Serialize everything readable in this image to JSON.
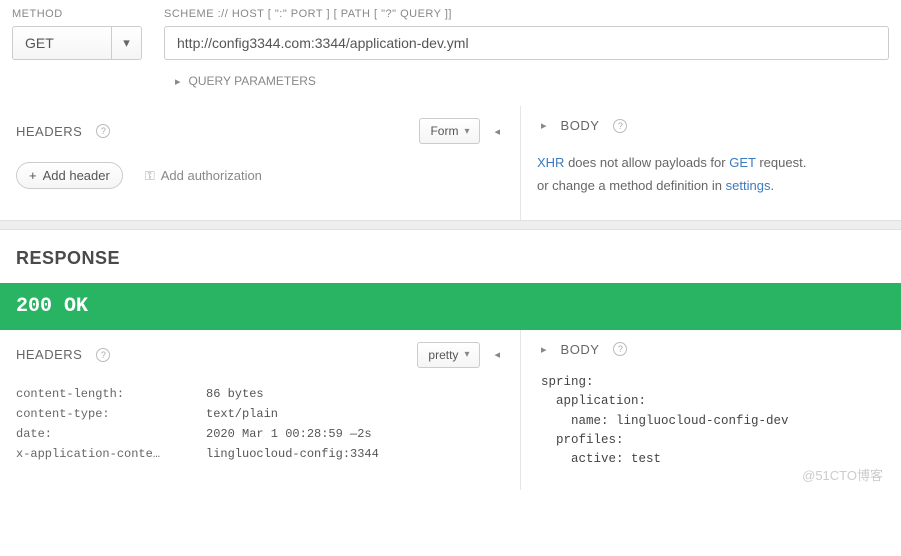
{
  "request": {
    "method_label": "METHOD",
    "method_value": "GET",
    "url_label": "SCHEME :// HOST [ \":\" PORT ] [ PATH [ \"?\" QUERY ]]",
    "url_value": "http://config3344.com:3344/application-dev.yml",
    "query_params_label": "QUERY PARAMETERS",
    "headers_label": "HEADERS",
    "form_label": "Form",
    "add_header": "Add header",
    "add_auth": "Add authorization",
    "body_label": "BODY",
    "body_msg_1a": "XHR",
    "body_msg_1b": " does not allow payloads for ",
    "body_msg_1c": "GET",
    "body_msg_1d": " request.",
    "body_msg_2a": "or change a method definition in ",
    "body_msg_2b": "settings",
    "body_msg_2c": "."
  },
  "response": {
    "title": "RESPONSE",
    "status": "200 OK",
    "headers_label": "HEADERS",
    "pretty_label": "pretty",
    "headers": [
      {
        "k": "content-length:",
        "v": "86 bytes"
      },
      {
        "k": "content-type:",
        "v": "text/plain"
      },
      {
        "k": "date:",
        "v": "2020 Mar 1 00:28:59 —2s"
      },
      {
        "k": "x-application-conte…",
        "v": "lingluocloud-config:3344"
      }
    ],
    "body_label": "BODY",
    "body_text": "spring:\n  application:\n    name: lingluocloud-config-dev\n  profiles:\n    active: test"
  },
  "watermark": "@51CTO博客"
}
